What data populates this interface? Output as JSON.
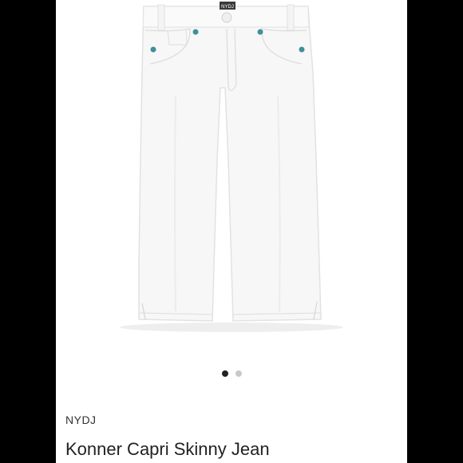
{
  "product": {
    "brand": "NYDJ",
    "title": "Konner Capri Skinny Jean",
    "waistband_label": "NYDJ"
  },
  "gallery": {
    "image_count": 2,
    "active_index": 0
  },
  "colors": {
    "background": "#000000",
    "panel": "#ffffff",
    "dot_active": "#222222",
    "dot_inactive": "#c9c9c9",
    "rivet": "#3f8f9c"
  },
  "icons": [
    "product-image"
  ]
}
